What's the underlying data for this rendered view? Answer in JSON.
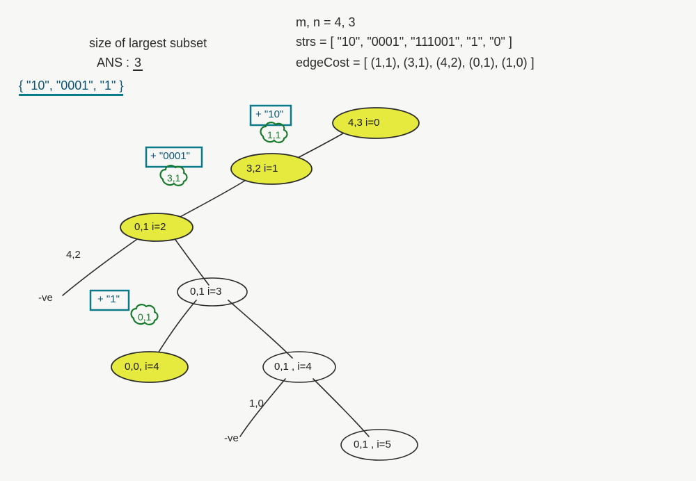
{
  "header": {
    "title_line": "size of largest subset",
    "answer_label": "ANS : ",
    "answer_value": "3",
    "subset_set": "{ \"10\", \"0001\", \"1\" }",
    "mn_line": "m, n = 4, 3",
    "strs_line": "strs = [ \"10\", \"0001\", \"111001\", \"1\", \"0\" ]",
    "edgecost_line": "edgeCost = [ (1,1), (3,1), (4,2), (0,1), (1,0) ]"
  },
  "nodes": {
    "n0": "4,3  i=0",
    "n1": "3,2  i=1",
    "n2": "0,1  i=2",
    "n3": "0,1  i=3",
    "n4": "0,0, i=4",
    "n5": "0,1 , i=4",
    "n6": "0,1 , i=5"
  },
  "edge_boxes": {
    "b0": "+ \"10\"",
    "b1": "+ \"0001\"",
    "b3": "+ \"1\""
  },
  "clouds": {
    "c0": "1,1",
    "c1": "3,1",
    "c3": "0,1"
  },
  "edge_labels": {
    "e2left": "4,2",
    "e2neg": "-ve",
    "e5left": "1,0",
    "e5neg": "-ve"
  }
}
